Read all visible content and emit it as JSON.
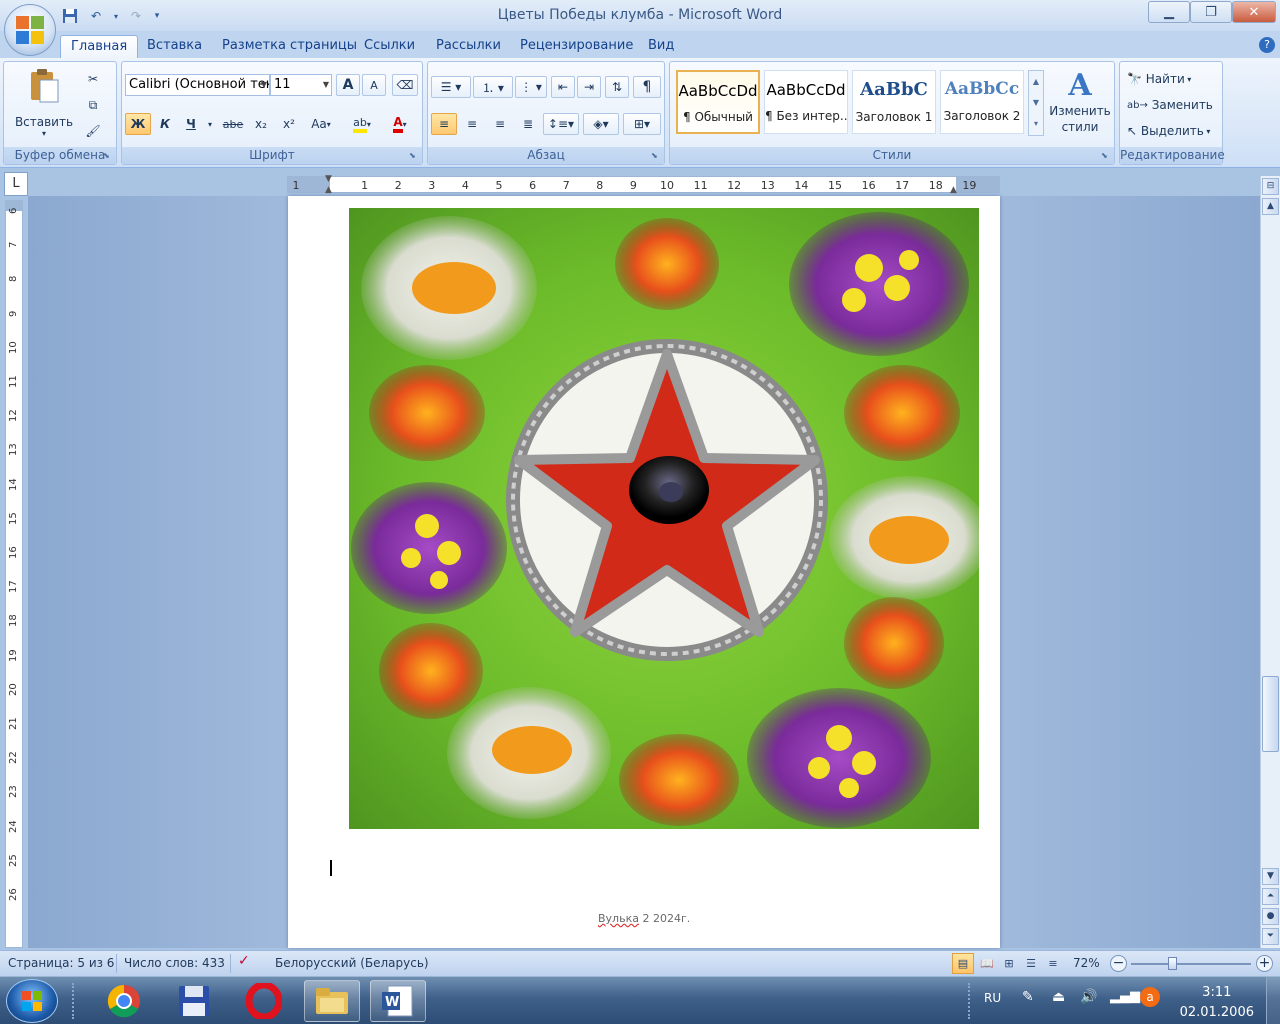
{
  "window": {
    "title": "Цветы Победы клумба - Microsoft Word"
  },
  "tabs": [
    {
      "label": "Главная",
      "active": true
    },
    {
      "label": "Вставка"
    },
    {
      "label": "Разметка страницы"
    },
    {
      "label": "Ссылки"
    },
    {
      "label": "Рассылки"
    },
    {
      "label": "Рецензирование"
    },
    {
      "label": "Вид"
    }
  ],
  "ribbon": {
    "clipboard": {
      "group_label": "Буфер обмена",
      "paste_label": "Вставить"
    },
    "font": {
      "group_label": "Шрифт",
      "font_name": "Calibri (Основной тек",
      "font_size": "11",
      "grow": "A",
      "shrink": "A",
      "bold": "Ж",
      "italic": "К",
      "underline": "Ч",
      "strike": "abe",
      "subscript": "x₂",
      "superscript": "x²",
      "change_case": "Aa",
      "highlight": "ab",
      "font_color": "A"
    },
    "paragraph": {
      "group_label": "Абзац",
      "show_marks": "¶"
    },
    "styles": {
      "group_label": "Стили",
      "items": [
        {
          "sample": "AaBbCcDd",
          "name": "¶ Обычный"
        },
        {
          "sample": "AaBbCcDd",
          "name": "¶ Без интер..."
        },
        {
          "sample": "AaBbC",
          "name": "Заголовок 1"
        },
        {
          "sample": "AaBbCc",
          "name": "Заголовок 2"
        }
      ],
      "change_styles": "Изменить стили"
    },
    "editing": {
      "group_label": "Редактирование",
      "find": "Найти",
      "replace": "Заменить",
      "select": "Выделить"
    }
  },
  "ruler": {
    "corner": "L",
    "h_numbers": [
      "1",
      "1",
      "2",
      "3",
      "4",
      "5",
      "6",
      "7",
      "8",
      "9",
      "10",
      "11",
      "12",
      "13",
      "14",
      "15",
      "16",
      "17",
      "18",
      "19"
    ],
    "v_numbers": [
      "6",
      "7",
      "8",
      "9",
      "10",
      "11",
      "12",
      "13",
      "14",
      "15",
      "16",
      "17",
      "18",
      "19",
      "20",
      "21",
      "22",
      "23",
      "24",
      "25",
      "26"
    ]
  },
  "document": {
    "footer_spell": "Вулька",
    "footer_rest": " 2  2024г."
  },
  "status": {
    "page": "Страница: 5 из 6",
    "words": "Число слов: 433",
    "language": "Белорусский (Беларусь)",
    "zoom": "72%",
    "zoom_level": 0.72
  },
  "taskbar": {
    "lang": "RU",
    "time": "3:11",
    "date": "02.01.2006"
  },
  "colors": {
    "ribbon_text": "#1e395b",
    "accent": "#15428b",
    "grass": "#6fb22e",
    "star_red": "#c8221a"
  }
}
